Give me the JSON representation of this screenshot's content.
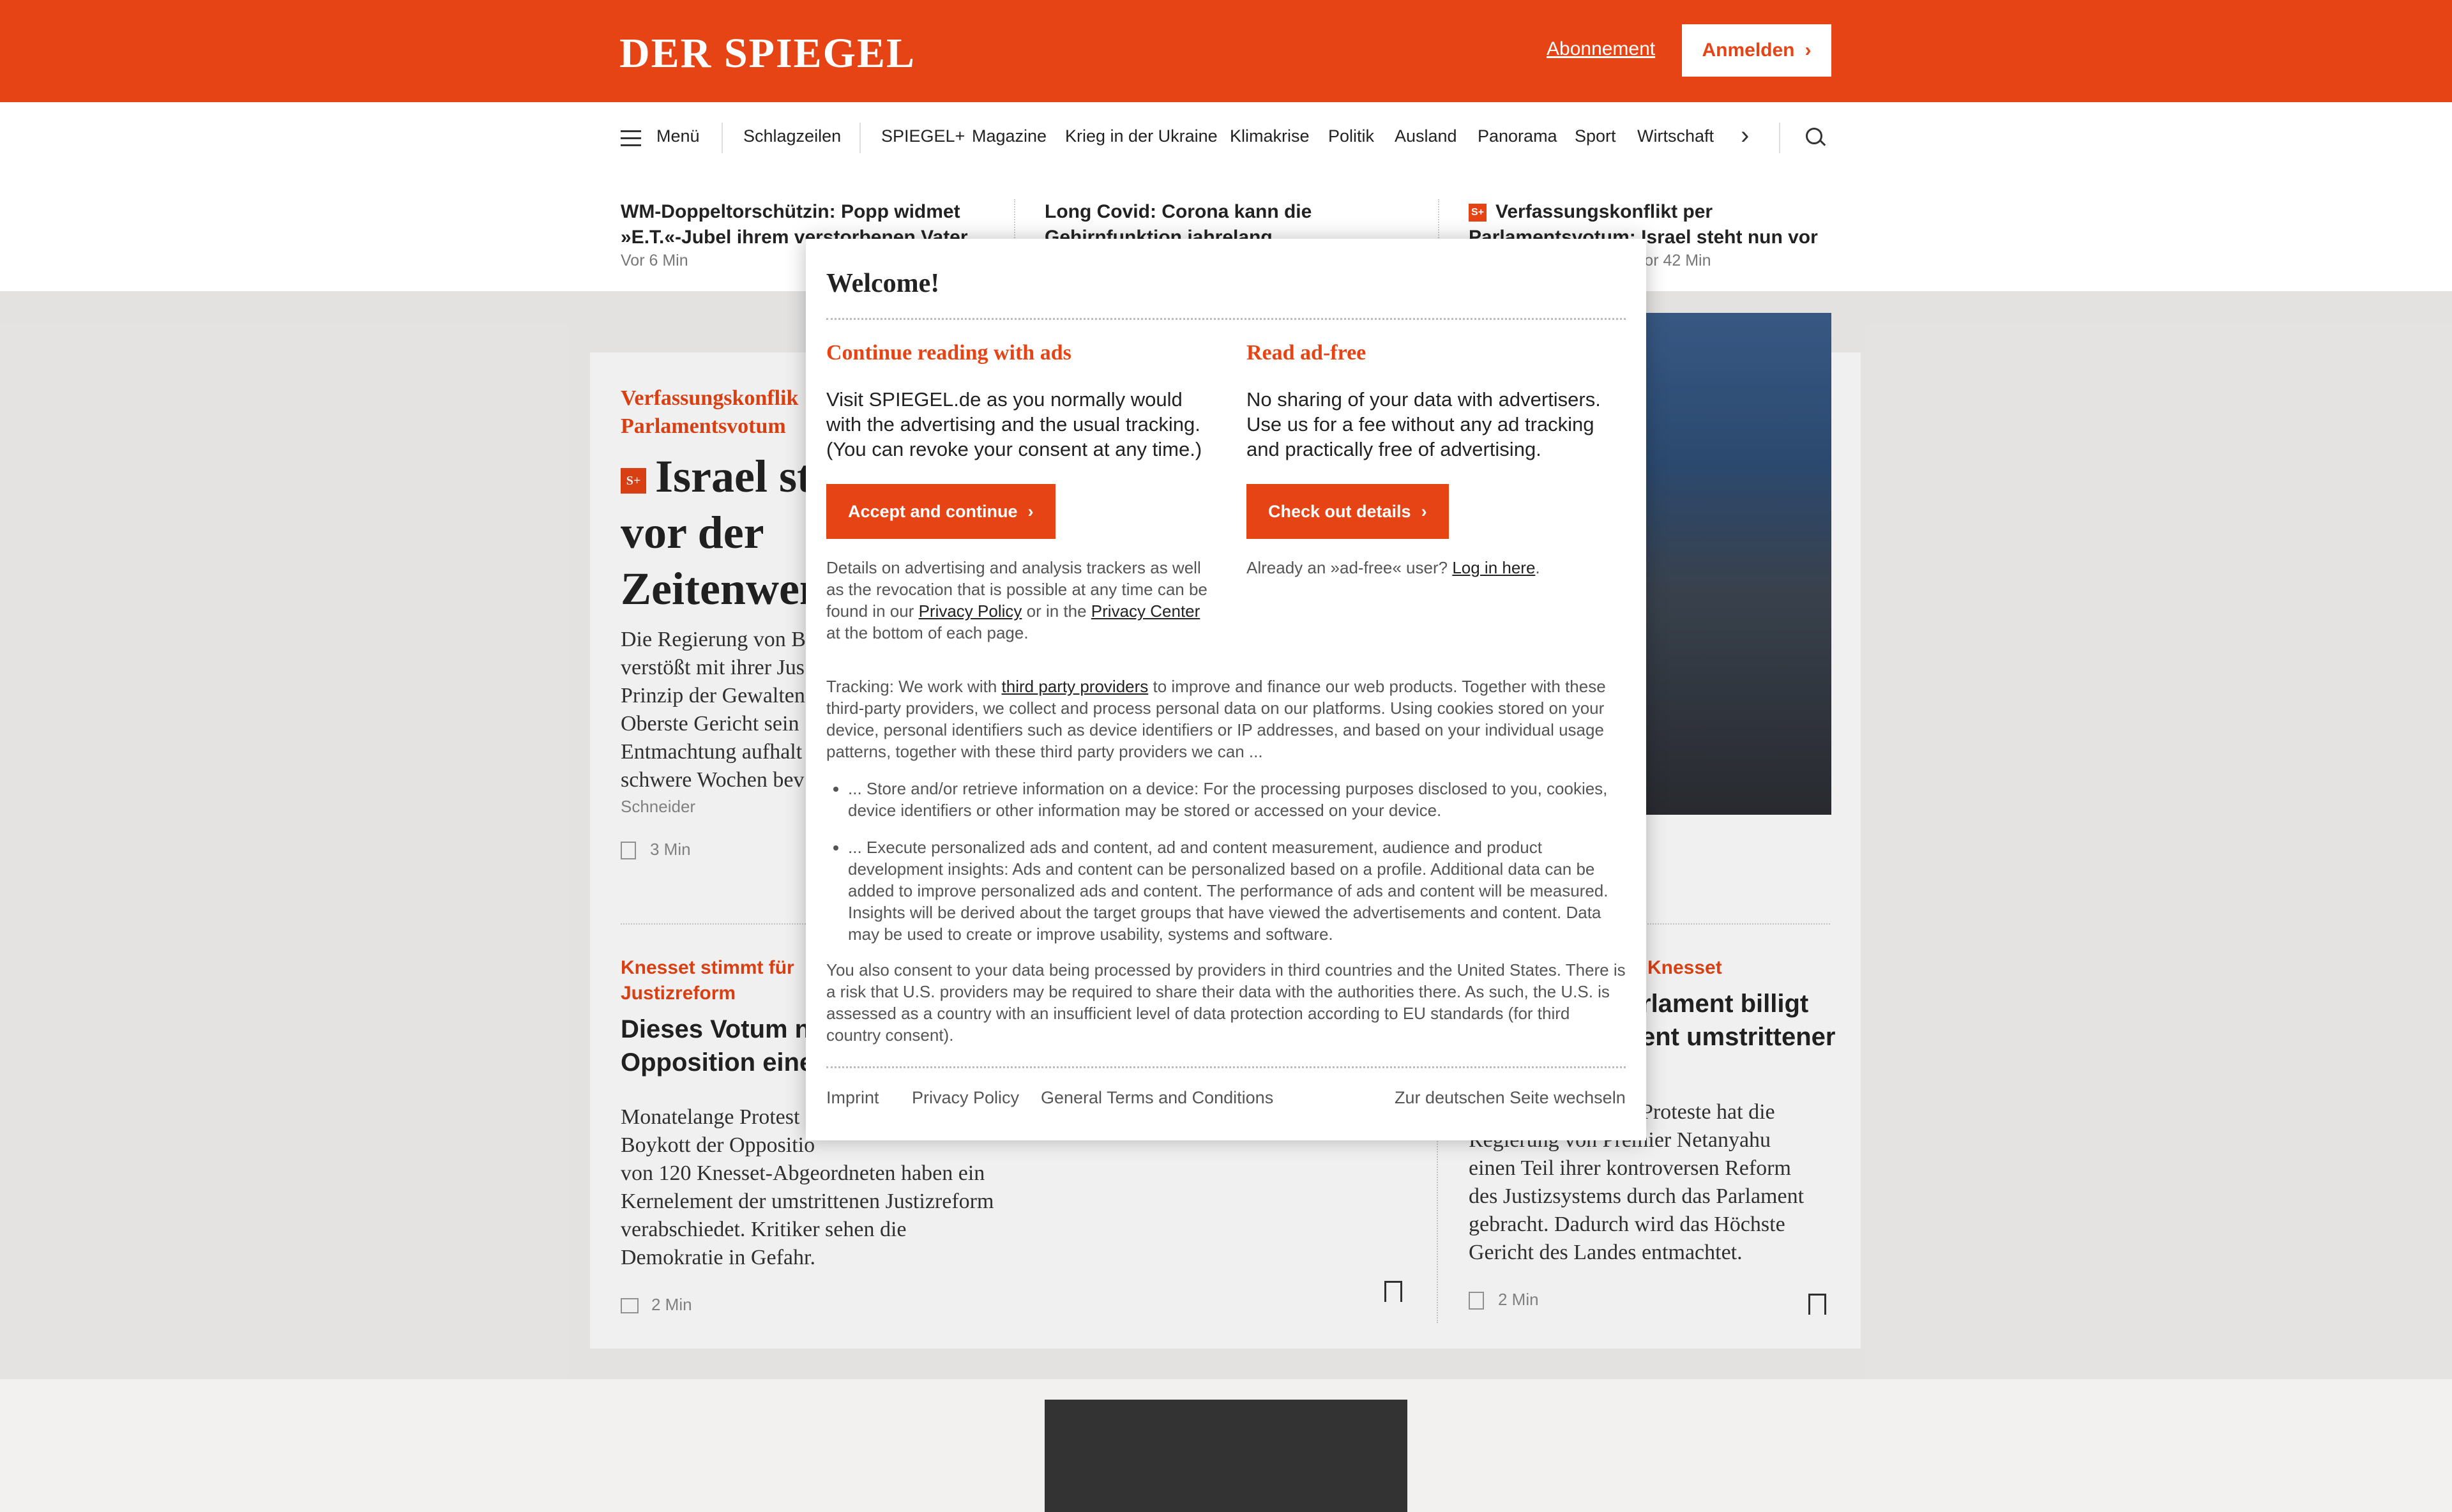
{
  "header": {
    "logo": "DER SPIEGEL",
    "subscribe_link": "Abonnement",
    "login_button": "Anmelden"
  },
  "nav": {
    "menu_label": "Menü",
    "items": [
      "Schlagzeilen",
      "SPIEGEL+",
      "Magazine",
      "Krieg in der Ukraine",
      "Klimakrise",
      "Politik",
      "Ausland",
      "Panorama",
      "Sport",
      "Wirtschaft"
    ]
  },
  "ticker": [
    {
      "title": "WM-Doppeltorschützin: Popp widmet »E.T.«-Jubel ihrem verstorbenen Vater",
      "time": "Vor 6 Min",
      "plus": false
    },
    {
      "title": "Long Covid: Corona kann die Gehirnfunktion jahrelang",
      "time": "",
      "plus": false
    },
    {
      "title": "Verfassungskonflikt per Parlamentsvotum: Israel steht nun vor",
      "time": "Vor 42 Min",
      "plus": true
    }
  ],
  "main_article": {
    "kicker": "Verfassungskonflikt per Parlamentsvotum",
    "kicker_visible_1": "Verfassungskonflik",
    "kicker_visible_2": "Parlamentsvotum",
    "title_1": "Israel st",
    "title_2": "vor der",
    "title_3": "Zeitenwen",
    "lead_lines": [
      "Die Regierung von B",
      "verstößt mit ihrer Jus",
      "Prinzip der Gewalten",
      "Oberste Gericht sein",
      "Entmachtung aufhalt",
      "schwere Wochen bev"
    ],
    "author": "Schneider",
    "reading_time": "3 Min"
  },
  "article_left": {
    "kicker_1": "Knesset stimmt für",
    "kicker_2": "Justizreform",
    "title_1": "Dieses Votum ne",
    "title_2": "Opposition eine",
    "lead_lines": [
      "Monatelange Protest",
      "Boykott der Oppositio",
      "von 120 Knesset-Abgeordneten haben ein",
      "Kernelement der umstrittenen Justizreform",
      "verabschiedet. Kritiker sehen die",
      "Demokratie in Gefahr."
    ],
    "reading_time": "2 Min"
  },
  "article_right": {
    "kicker": "Knesset",
    "title_1": "rlament billigt",
    "title_2": "ent umstrittener",
    "lead_lines": [
      "Proteste hat die",
      "Regierung von Premier Netanyahu",
      "einen Teil ihrer kontroversen Reform",
      "des Justizsystems durch das Parlament",
      "gebracht. Dadurch wird das Höchste",
      "Gericht des Landes entmachtet."
    ],
    "reading_time": "2 Min"
  },
  "dialog": {
    "title": "Welcome!",
    "left": {
      "heading": "Continue reading with ads",
      "text": "Visit SPIEGEL.de as you normally would with the advertising and the usual tracking. (You can revoke your consent at any time.)",
      "button": "Accept and continue",
      "details_pre": "Details on advertising and analysis trackers as well as the revocation that is possible at any time can be found in our ",
      "privacy_policy_link": "Privacy Policy",
      "details_mid": " or in the ",
      "privacy_center_link": "Privacy Center",
      "details_post": " at the bottom of each page."
    },
    "right": {
      "heading": "Read ad-free",
      "text": "No sharing of your data with advertisers. Use us for a fee without any ad tracking and practically free of advertising.",
      "button": "Check out details",
      "already_pre": "Already an »ad-free« user? ",
      "login_link": "Log in here",
      "already_post": "."
    },
    "tracking_pre": "Tracking: We work with ",
    "third_party_link": "third party providers",
    "tracking_post": " to improve and finance our web products. Together with these third-party providers, we collect and process personal data on our platforms. Using cookies stored on your device, personal identifiers such as device identifiers or IP addresses, and based on your individual usage patterns, together with these third party providers we can ...",
    "bullets": [
      "... Store and/or retrieve information on a device: For the processing purposes disclosed to you, cookies, device identifiers or other information may be stored or accessed on your device.",
      "... Execute personalized ads and content, ad and content measurement, audience and product development insights: Ads and content can be personalized based on a profile. Additional data can be added to improve personalized ads and content. The performance of ads and content will be measured. Insights will be derived about the target groups that have viewed the advertisements and content. Data may be used to create or improve usability, systems and software."
    ],
    "consent_text": "You also consent to your data being processed by providers in third countries and the United States. There is a risk that U.S. providers may be required to share their data with the authorities there. As such, the U.S. is assessed as a country with an insufficient level of data protection according to EU standards (for third country consent).",
    "footer": {
      "imprint": "Imprint",
      "privacy_policy": "Privacy Policy",
      "terms": "General Terms and Conditions",
      "german": "Zur deutschen Seite wechseln"
    }
  },
  "colors": {
    "brand": "#e64415",
    "white": "#ffffff"
  }
}
